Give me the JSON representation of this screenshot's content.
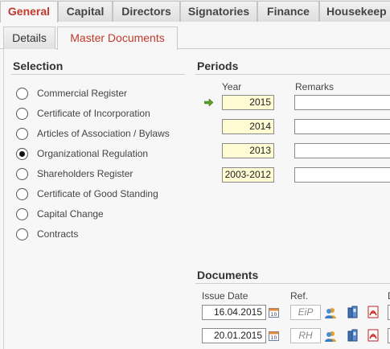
{
  "top_tabs": [
    {
      "label": "General",
      "active": true
    },
    {
      "label": "Capital",
      "active": false
    },
    {
      "label": "Directors",
      "active": false
    },
    {
      "label": "Signatories",
      "active": false
    },
    {
      "label": "Finance",
      "active": false
    },
    {
      "label": "Housekeep",
      "active": false
    }
  ],
  "sub_tabs": [
    {
      "label": "Details",
      "active": false
    },
    {
      "label": "Master Documents",
      "active": true
    }
  ],
  "selection": {
    "title": "Selection",
    "items": [
      {
        "label": "Commercial Register",
        "checked": false
      },
      {
        "label": "Certificate of Incorporation",
        "checked": false
      },
      {
        "label": "Articles of Association / Bylaws",
        "checked": false
      },
      {
        "label": "Organizational Regulation",
        "checked": true
      },
      {
        "label": "Shareholders Register",
        "checked": false
      },
      {
        "label": "Certificate of Good Standing",
        "checked": false
      },
      {
        "label": "Capital Change",
        "checked": false
      },
      {
        "label": "Contracts",
        "checked": false
      }
    ]
  },
  "periods": {
    "title": "Periods",
    "col_year": "Year",
    "col_remarks": "Remarks",
    "rows": [
      {
        "year": "2015",
        "remarks": "",
        "current": true
      },
      {
        "year": "2014",
        "remarks": "",
        "current": false
      },
      {
        "year": "2013",
        "remarks": "",
        "current": false
      },
      {
        "year": "2003-2012",
        "remarks": "",
        "current": false
      }
    ]
  },
  "documents": {
    "title": "Documents",
    "col_issue_date": "Issue Date",
    "col_ref": "Ref.",
    "col_clipped": "D",
    "rows": [
      {
        "issue_date": "16.04.2015",
        "ref": "EiP"
      },
      {
        "issue_date": "20.01.2015",
        "ref": "RH"
      }
    ]
  },
  "colors": {
    "accent": "#c0392b",
    "year_bg": "#fffbd2",
    "arrow": "#5aa02c"
  }
}
